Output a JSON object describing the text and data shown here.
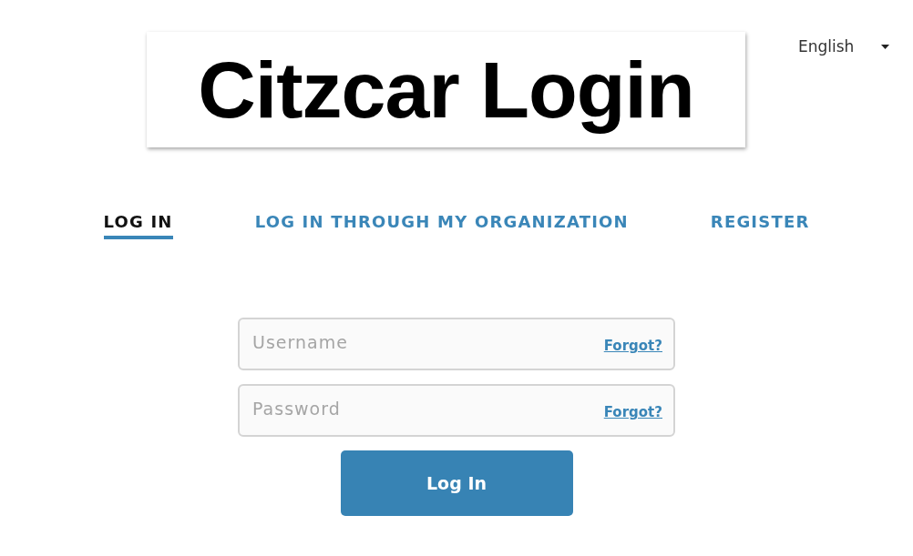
{
  "logo": {
    "title": "Citzcar Login"
  },
  "language": {
    "value": "English"
  },
  "tabs": [
    {
      "label": "LOG IN",
      "selected": true
    },
    {
      "label": "LOG IN THROUGH MY ORGANIZATION",
      "selected": false
    },
    {
      "label": "REGISTER",
      "selected": false
    }
  ],
  "fields": [
    {
      "placeholder": "Username",
      "link": "Forgot?"
    },
    {
      "placeholder": "Password",
      "link": "Forgot?"
    }
  ],
  "submit": {
    "label": "Log In"
  }
}
